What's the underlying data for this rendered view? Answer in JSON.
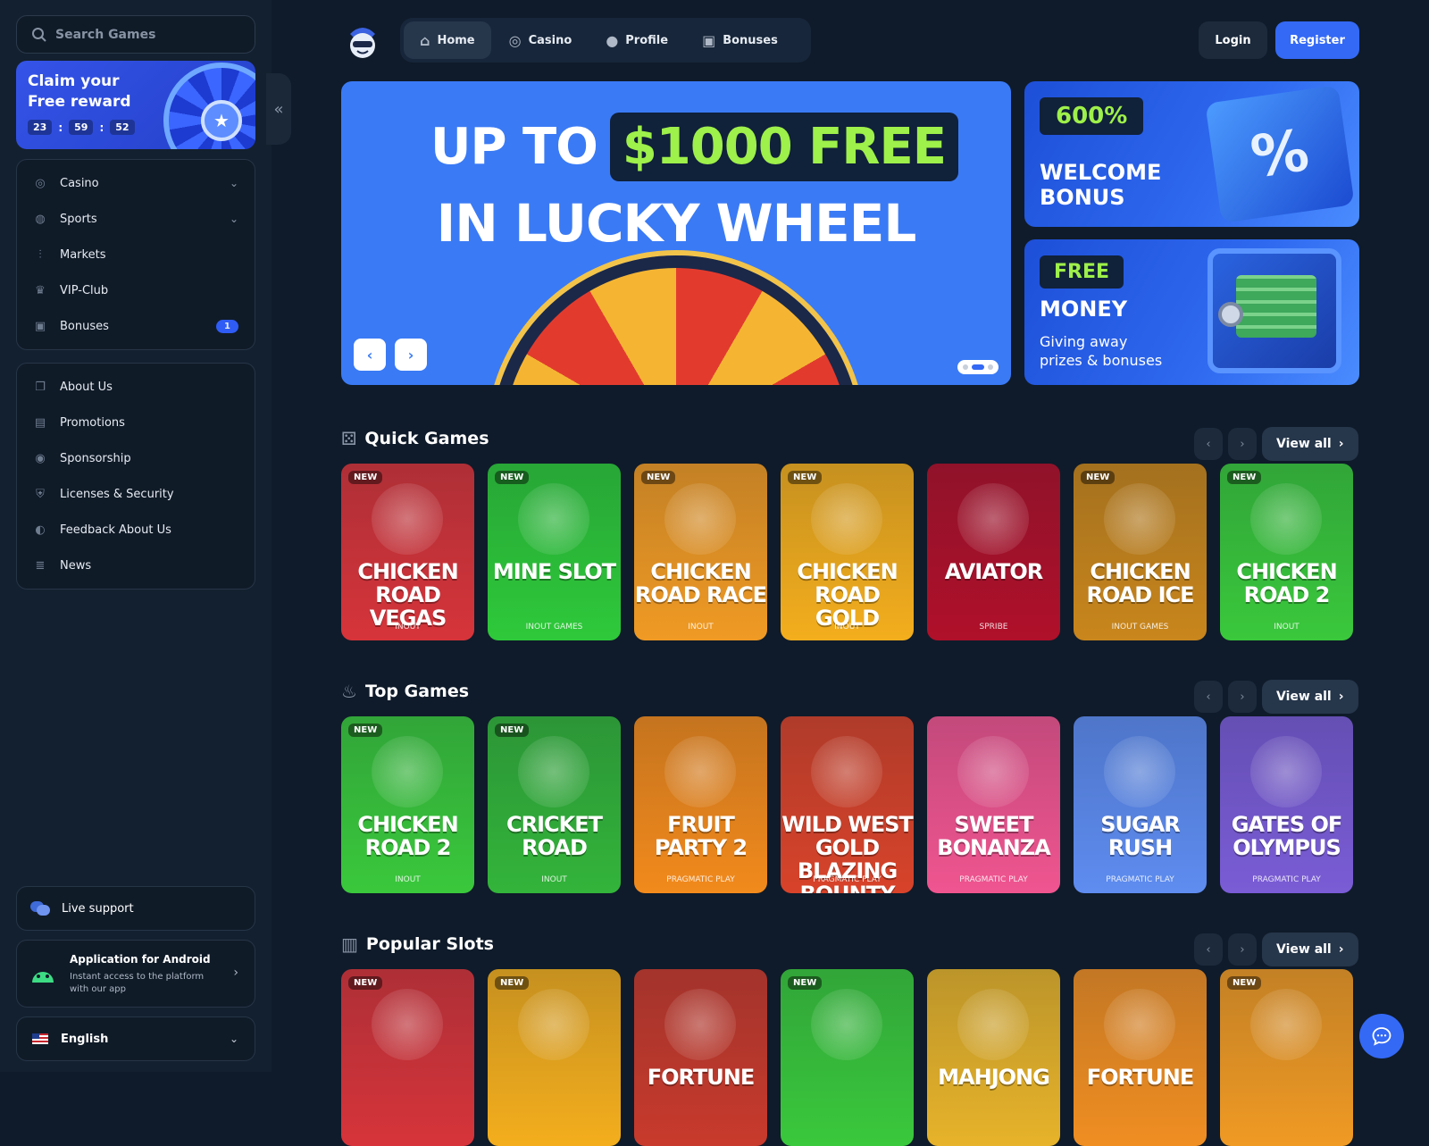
{
  "search": {
    "placeholder": "Search Games"
  },
  "promo": {
    "title": "Claim your Free reward",
    "timer": [
      "23",
      "59",
      "52"
    ]
  },
  "nav_main": [
    {
      "label": "Casino",
      "icon": "casino-chip-icon",
      "has_chevron": true
    },
    {
      "label": "Sports",
      "icon": "globe-icon",
      "has_chevron": true
    },
    {
      "label": "Markets",
      "icon": "candlestick-icon",
      "has_chevron": false
    },
    {
      "label": "VIP-Club",
      "icon": "crown-icon",
      "has_chevron": false
    },
    {
      "label": "Bonuses",
      "icon": "gift-icon",
      "badge": "1"
    }
  ],
  "nav_info": [
    {
      "label": "About Us",
      "icon": "book-icon"
    },
    {
      "label": "Promotions",
      "icon": "ticket-icon"
    },
    {
      "label": "Sponsorship",
      "icon": "medal-icon"
    },
    {
      "label": "Licenses & Security",
      "icon": "shield-icon"
    },
    {
      "label": "Feedback About Us",
      "icon": "megaphone-icon"
    },
    {
      "label": "News",
      "icon": "newspaper-icon"
    }
  ],
  "support": {
    "label": "Live support"
  },
  "android": {
    "title": "Application for Android",
    "subtitle": "Instant access to the platform with our app"
  },
  "language": {
    "label": "English"
  },
  "topnav": {
    "tabs": [
      {
        "label": "Home",
        "icon": "home-icon",
        "active": true
      },
      {
        "label": "Casino",
        "icon": "casino-chip-icon",
        "active": false
      },
      {
        "label": "Profile",
        "icon": "user-icon",
        "active": false
      },
      {
        "label": "Bonuses",
        "icon": "gift-icon",
        "active": false
      }
    ]
  },
  "auth": {
    "login": "Login",
    "register": "Register"
  },
  "hero": {
    "line1_prefix": "UP TO",
    "line1_highlight": "$1000 FREE",
    "line2": "IN LUCKY WHEEL",
    "slide_count": 3,
    "active_slide": 2
  },
  "side_banners": [
    {
      "tag": "600%",
      "title": "WELCOME BONUS"
    },
    {
      "tag": "FREE",
      "title": "MONEY",
      "subtitle": "Giving away prizes & bonuses"
    }
  ],
  "sections": [
    {
      "title": "Quick Games",
      "icon": "dice-icon",
      "view_all": "View all",
      "games": [
        {
          "title": "CHICKEN ROAD VEGAS",
          "provider": "INOUT",
          "new": true,
          "bg": "#d6343a"
        },
        {
          "title": "MINE SLOT",
          "provider": "INOUT GAMES",
          "new": true,
          "bg": "#2ec93a"
        },
        {
          "title": "CHICKEN ROAD RACE",
          "provider": "INOUT",
          "new": true,
          "bg": "#f09a24"
        },
        {
          "title": "CHICKEN ROAD GOLD",
          "provider": "INOUT",
          "new": true,
          "bg": "#f4ae1d"
        },
        {
          "title": "AVIATOR",
          "provider": "SPRIBE",
          "new": false,
          "bg": "#b0102a"
        },
        {
          "title": "CHICKEN ROAD ICE",
          "provider": "INOUT GAMES",
          "new": true,
          "bg": "#c9861c"
        },
        {
          "title": "CHICKEN ROAD 2",
          "provider": "INOUT",
          "new": true,
          "bg": "#3ac83c"
        }
      ]
    },
    {
      "title": "Top Games",
      "icon": "flame-icon",
      "view_all": "View all",
      "games": [
        {
          "title": "CHICKEN ROAD 2",
          "provider": "INOUT",
          "new": true,
          "bg": "#3ac83c"
        },
        {
          "title": "CRICKET ROAD",
          "provider": "INOUT",
          "new": true,
          "bg": "#33b43a"
        },
        {
          "title": "FRUIT PARTY 2",
          "provider": "PRAGMATIC PLAY",
          "new": false,
          "bg": "#f28a1c"
        },
        {
          "title": "WILD WEST GOLD BLAZING BOUNTY",
          "provider": "PRAGMATIC PLAY",
          "new": false,
          "bg": "#d8432a"
        },
        {
          "title": "SWEET BONANZA",
          "provider": "PRAGMATIC PLAY",
          "new": false,
          "bg": "#f05590"
        },
        {
          "title": "SUGAR RUSH",
          "provider": "PRAGMATIC PLAY",
          "new": false,
          "bg": "#5e8cf0"
        },
        {
          "title": "GATES OF OLYMPUS",
          "provider": "PRAGMATIC PLAY",
          "new": false,
          "bg": "#7a5cd6"
        }
      ]
    },
    {
      "title": "Popular Slots",
      "icon": "slots-icon",
      "view_all": "View all",
      "games": [
        {
          "title": "",
          "provider": "",
          "new": true,
          "bg": "#d6343a"
        },
        {
          "title": "",
          "provider": "",
          "new": true,
          "bg": "#f4ae1d"
        },
        {
          "title": "FORTUNE",
          "provider": "",
          "new": false,
          "bg": "#c83a2c"
        },
        {
          "title": "",
          "provider": "",
          "new": true,
          "bg": "#3ac83c"
        },
        {
          "title": "MAHJONG",
          "provider": "",
          "new": false,
          "bg": "#e7b32a"
        },
        {
          "title": "FORTUNE",
          "provider": "",
          "new": false,
          "bg": "#f08e22"
        },
        {
          "title": "",
          "provider": "",
          "new": true,
          "bg": "#f09a24"
        }
      ]
    }
  ],
  "new_badge": "NEW"
}
